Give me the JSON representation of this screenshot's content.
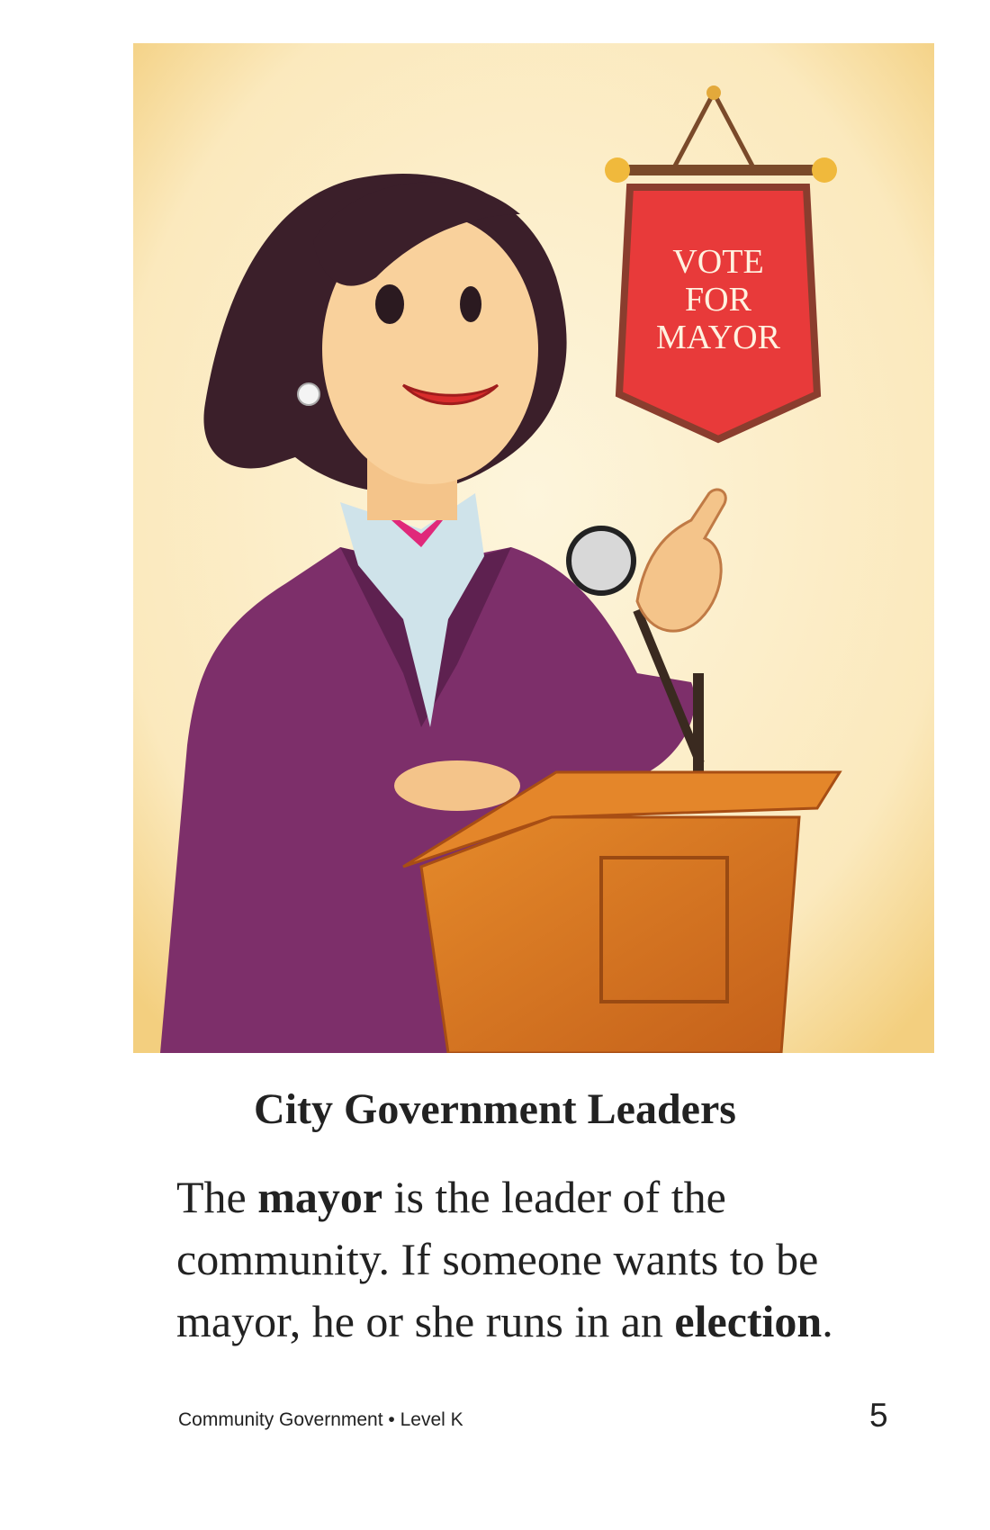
{
  "illustration": {
    "banner_lines": [
      "VOTE",
      "FOR",
      "MAYOR"
    ]
  },
  "heading": "City Government Leaders",
  "paragraph": {
    "line1_pre": "The ",
    "line1_bold": "mayor",
    "line1_post": " is the leader of the",
    "line2": "community. If someone wants to be",
    "line3_pre": "mayor, he or she runs in an ",
    "line3_bold": "election",
    "line3_post": "."
  },
  "footer": {
    "book_title": "Community Government",
    "separator": "•",
    "level": "Level K",
    "page_number": "5"
  },
  "colors": {
    "background": "#fdf2d6",
    "banner": "#e83a3a",
    "jacket": "#7d2f6a",
    "podium": "#d8731f"
  }
}
